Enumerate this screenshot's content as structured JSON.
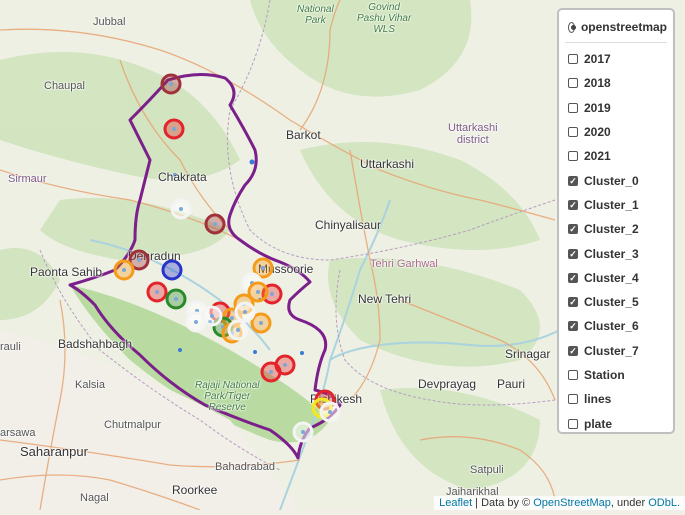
{
  "map": {
    "place_labels": {
      "jubbal": "Jubbal",
      "chaupal": "Chaupal",
      "barkot": "Barkot",
      "sirmaur": "Sirmaur",
      "chakrata": "Chakrata",
      "uttarkashi": "Uttarkashi",
      "uttarkashi_district": "Uttarkashi\ndistrict",
      "chinyalisaur": "Chinyalisaur",
      "tehri_garhwal": "Tehri Garhwal",
      "new_tehri": "New Tehri",
      "paonta": "Paonta Sahib",
      "dehradun": "Dehradun",
      "mussoorie": "Mussoorie",
      "badshahbagh": "Badshahbagh",
      "srinagar": "Srinagar",
      "kalsia": "Kalsia",
      "devprayag": "Devprayag",
      "pauri": "Pauri",
      "rajaji": "Rajaji National\nPark/Tiger\nReserve",
      "rishikesh": "Rishikesh",
      "chutmalpur": "Chutmalpur",
      "saharanpur": "Saharanpur",
      "bahadrabad": "Bahadrabad",
      "satpuli": "Satpuli",
      "roorkee": "Roorkee",
      "nagal": "Nagal",
      "jaiharikhal": "Jaiharikhal",
      "rauli": "rauli",
      "arsawa": "arsawa",
      "govind": "Govind\nPashu Vihar\nWLS",
      "national_park": "National\nPark"
    }
  },
  "layer_control": {
    "base_layer": {
      "label": "openstreetmap",
      "selected": true
    },
    "overlays": [
      {
        "label": "2017",
        "checked": false
      },
      {
        "label": "2018",
        "checked": false
      },
      {
        "label": "2019",
        "checked": false
      },
      {
        "label": "2020",
        "checked": false
      },
      {
        "label": "2021",
        "checked": false
      },
      {
        "label": "Cluster_0",
        "checked": true
      },
      {
        "label": "Cluster_1",
        "checked": true
      },
      {
        "label": "Cluster_2",
        "checked": true
      },
      {
        "label": "Cluster_3",
        "checked": true
      },
      {
        "label": "Cluster_4",
        "checked": true
      },
      {
        "label": "Cluster_5",
        "checked": true
      },
      {
        "label": "Cluster_6",
        "checked": true
      },
      {
        "label": "Cluster_7",
        "checked": true
      },
      {
        "label": "Station",
        "checked": false
      },
      {
        "label": "lines",
        "checked": false
      },
      {
        "label": "plate",
        "checked": false
      }
    ]
  },
  "attribution": {
    "leaflet": "Leaflet",
    "data_by": " | Data by © ",
    "osm": "OpenStreetMap",
    "under": ", under ",
    "odbl": "ODbL."
  },
  "colors": {
    "boundary": "#7b1f8a",
    "cluster_red": "#e3242b",
    "cluster_darkred": "#a0303a",
    "cluster_orange": "#f59b1a",
    "cluster_blue": "#2833c9",
    "cluster_green": "#2a8a2a",
    "cluster_white": "#ffffff",
    "cluster_yellow": "#f3ea1c"
  }
}
